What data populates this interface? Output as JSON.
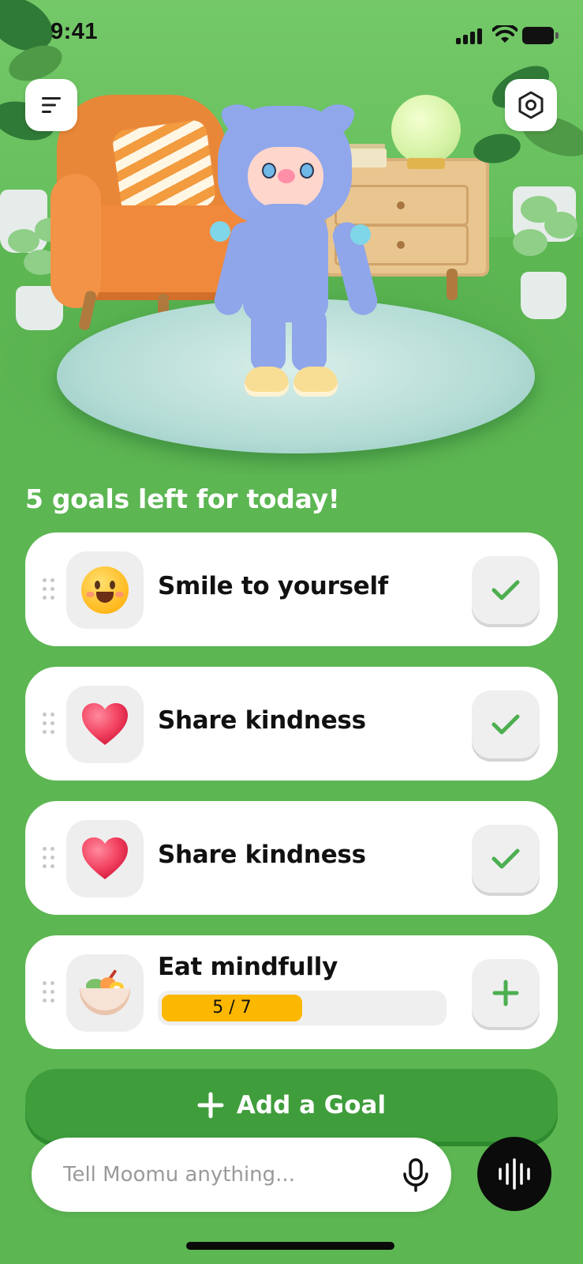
{
  "status_bar": {
    "time": "9:41"
  },
  "header": {
    "menu_icon": "menu-lines-icon",
    "settings_icon": "hexagon-settings-icon"
  },
  "goals": {
    "heading": "5 goals left for today!",
    "items": [
      {
        "title": "Smile to yourself",
        "icon": "smiley-face-icon",
        "action": "check-icon",
        "action_color": "#4caf50"
      },
      {
        "title": "Share kindness",
        "icon": "red-heart-icon",
        "action": "check-icon",
        "action_color": "#4caf50"
      },
      {
        "title": "Share kindness",
        "icon": "red-heart-icon",
        "action": "check-icon",
        "action_color": "#4caf50"
      },
      {
        "title": "Eat mindfully",
        "icon": "food-bowl-icon",
        "action": "plus-icon",
        "action_color": "#4caf50",
        "progress": {
          "label": "5 / 7",
          "current": 5,
          "total": 7,
          "fill_color": "#fcb700"
        }
      }
    ]
  },
  "add_goal": {
    "label": "Add a Goal"
  },
  "chat": {
    "placeholder": "Tell Moomu anything...",
    "mic_icon": "microphone-icon",
    "voice_icon": "voice-waveform-icon"
  },
  "colors": {
    "background": "#5cb652",
    "add_goal_button": "#3f9d3c",
    "check": "#4caf50",
    "progress_fill": "#fcb700"
  }
}
